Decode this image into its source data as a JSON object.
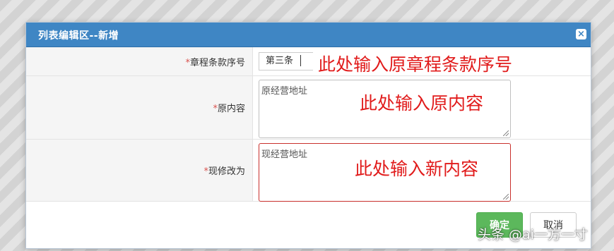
{
  "dialog": {
    "title": "列表编辑区--新增",
    "close_icon": "×"
  },
  "fields": [
    {
      "required_mark": "*",
      "label": "章程条款序号",
      "value": "第三条",
      "annotation": "此处输入原章程条款序号"
    },
    {
      "required_mark": "*",
      "label": "原内容",
      "value": "原经营地址",
      "annotation": "此处输入原内容"
    },
    {
      "required_mark": "*",
      "label": "现修改为",
      "value": "现经营地址",
      "annotation": "此处输入新内容"
    }
  ],
  "buttons": {
    "confirm": "确定",
    "cancel": "取消"
  },
  "watermark": "头条 @ai一方一寸",
  "colors": {
    "titlebar": "#3f86c4",
    "annotation": "#e11b1b",
    "confirm": "#5cb85c",
    "required": "#d9534f"
  }
}
